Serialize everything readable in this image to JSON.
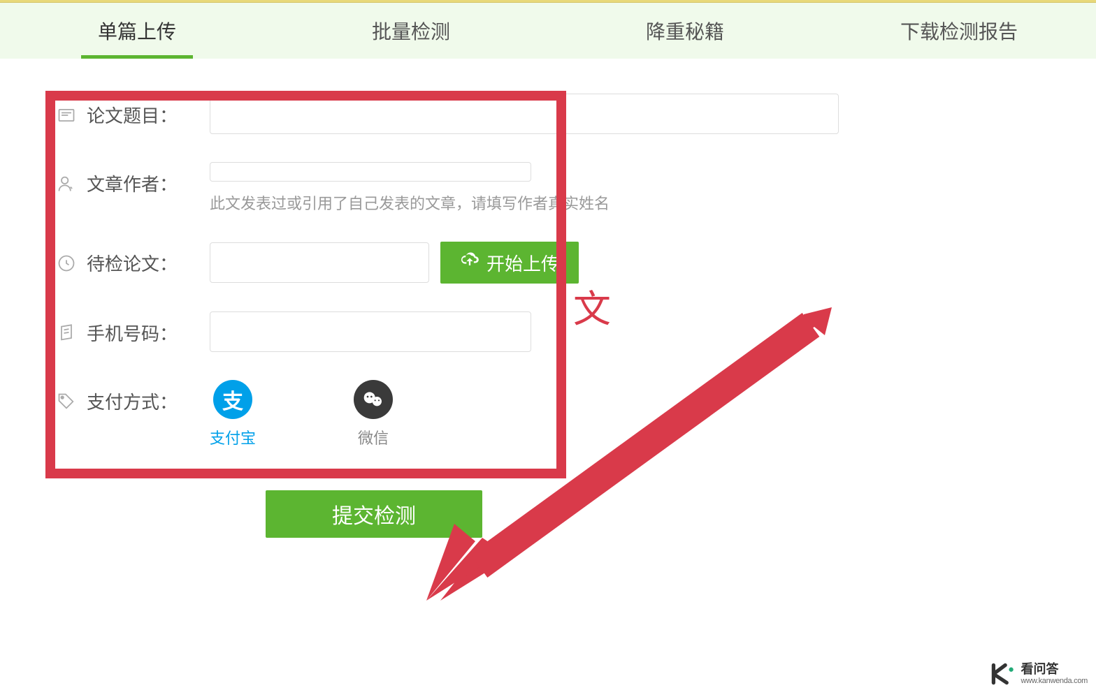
{
  "tabs": [
    {
      "label": "单篇上传",
      "active": true
    },
    {
      "label": "批量检测",
      "active": false
    },
    {
      "label": "降重秘籍",
      "active": false
    },
    {
      "label": "下载检测报告",
      "active": false
    }
  ],
  "form": {
    "title_label": "论文题目：",
    "author_label": "文章作者：",
    "author_hint": "此文发表过或引用了自己发表的文章，请填写作者真实姓名",
    "paper_label": "待检论文：",
    "upload_button": "开始上传",
    "phone_label": "手机号码：",
    "payment_label": "支付方式：",
    "payment_options": {
      "alipay": "支付宝",
      "wechat": "微信"
    },
    "submit_button": "提交检测"
  },
  "watermark": {
    "brand": "看问答",
    "url": "www.kanwenda.com"
  },
  "annotation_char": "文"
}
